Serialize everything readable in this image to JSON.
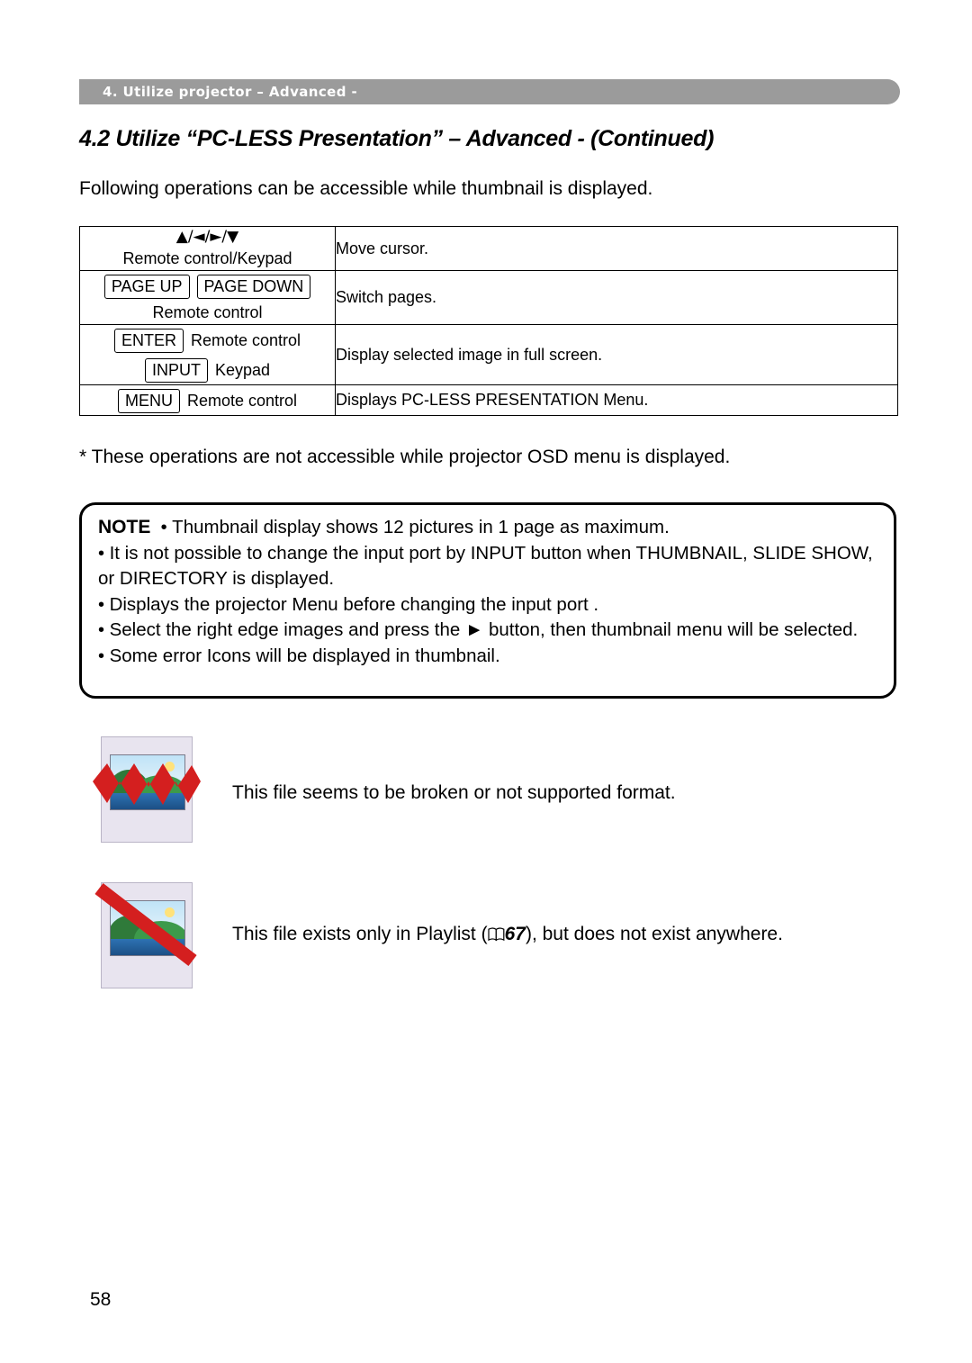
{
  "header": {
    "chapter_label": "4. Utilize projector – Advanced -"
  },
  "section": {
    "title": "4.2 Utilize “PC-LESS Presentation” – Advanced - (Continued)",
    "intro": "Following operations can be accessible while thumbnail is displayed."
  },
  "table": {
    "rows": [
      {
        "key_symbols": "▲/◄/►/▼",
        "key_source": "Remote control/Keypad",
        "boxes": [],
        "description": "Move cursor."
      },
      {
        "key_symbols": "",
        "key_source": "Remote control",
        "boxes": [
          "PAGE UP",
          "PAGE DOWN"
        ],
        "description": "Switch pages."
      },
      {
        "key_symbols": "",
        "key_source": "",
        "boxes": [
          "ENTER",
          "INPUT"
        ],
        "box_labels": [
          "Remote control",
          "Keypad"
        ],
        "description": "Display selected image in full screen."
      },
      {
        "key_symbols": "",
        "key_source": "",
        "boxes": [
          "MENU"
        ],
        "box_labels": [
          "Remote control"
        ],
        "description": "Displays PC-LESS PRESENTATION Menu."
      }
    ]
  },
  "star_note": "* These operations are not accessible while projector OSD menu is displayed.",
  "note": {
    "label": "NOTE",
    "bullets": [
      "Thumbnail display shows 12 pictures in 1 page as maximum.",
      "It is not possible to change the input port by INPUT button when THUMBNAIL, SLIDE SHOW, or DIRECTORY is displayed.",
      "Displays the projector Menu before changing the input port .",
      "Select the right edge images and press the ► button, then thumbnail menu will be selected.",
      "Some error Icons will be displayed in thumbnail."
    ]
  },
  "figures": [
    {
      "icon": "broken-image-icon",
      "caption": "This file seems to be broken or not supported format."
    },
    {
      "icon": "missing-file-icon",
      "caption_before": "This file exists only in Playlist (",
      "caption_ref": "67",
      "caption_after": "), but does not exist anywhere."
    }
  ],
  "page_number": "58",
  "colors": {
    "header_bar": "#9b9b9b",
    "error_red": "#d41f1f",
    "thumb_bg": "#e8e4ef"
  }
}
